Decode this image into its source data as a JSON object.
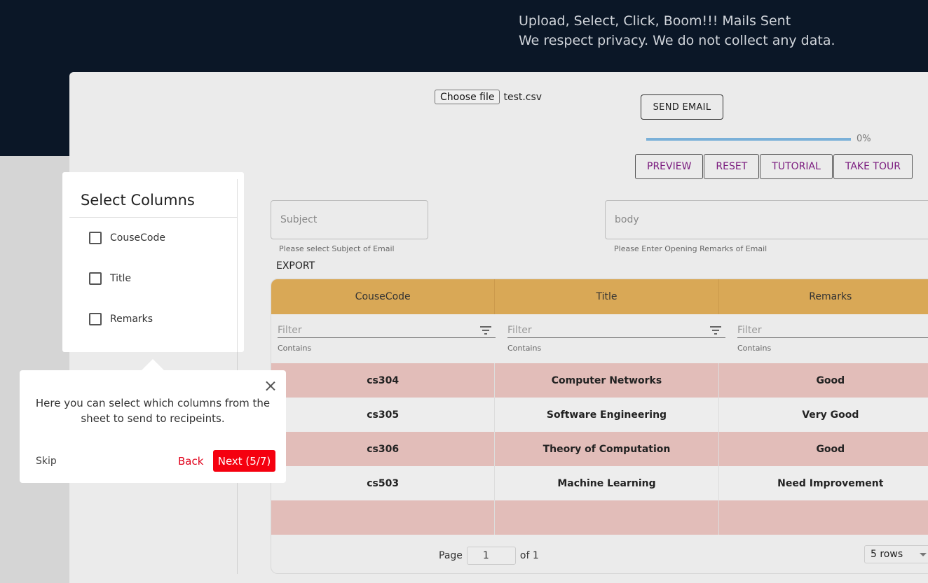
{
  "hero": {
    "line1": "Upload, Select, Click, Boom!!! Mails Sent",
    "line2": "We respect privacy. We do not collect any data."
  },
  "upload": {
    "choose_label": "Choose file",
    "file_name": "test.csv"
  },
  "send_email_label": "SEND EMAIL",
  "progress": {
    "value": 0,
    "label": "0%"
  },
  "actions": {
    "preview": "PREVIEW",
    "reset": "RESET",
    "tutorial": "TUTORIAL",
    "take_tour": "TAKE TOUR"
  },
  "subject": {
    "placeholder": "Subject",
    "helper": "Please select Subject of Email"
  },
  "body": {
    "placeholder": "body",
    "helper": "Please Enter Opening Remarks of Email"
  },
  "export_label": "EXPORT",
  "grid": {
    "columns": [
      "CouseCode",
      "Title",
      "Remarks"
    ],
    "filter_placeholder": "Filter",
    "filter_mode": "Contains",
    "rows": [
      [
        "cs304",
        "Computer Networks",
        "Good"
      ],
      [
        "cs305",
        "Software Engineering",
        "Very Good"
      ],
      [
        "cs306",
        "Theory of Computation",
        "Good"
      ],
      [
        "cs503",
        "Machine Learning",
        "Need Improvement"
      ]
    ],
    "pager": {
      "page_label": "Page",
      "page_value": "1",
      "of_label": "of 1",
      "rows_label": "5 rows"
    }
  },
  "select_columns": {
    "title": "Select Columns",
    "items": [
      "CouseCode",
      "Title",
      "Remarks"
    ]
  },
  "tour": {
    "text": "Here you can select which columns from the sheet to send to recipeints.",
    "skip": "Skip",
    "back": "Back",
    "next": "Next (5/7)"
  },
  "colors": {
    "hero_bg": "#0b1727",
    "header_bg": "#d9a856",
    "row_pink": "#e2bdb9",
    "accent_purple": "#7a1a7e",
    "tour_red": "#f5000f"
  }
}
